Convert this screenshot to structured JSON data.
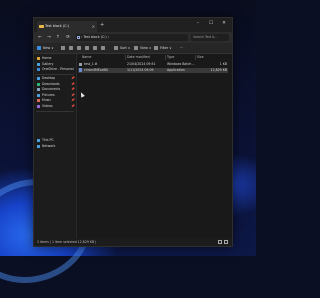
{
  "window": {
    "tab_title": "Test block (C:)",
    "tab_close": "×",
    "new_tab": "+",
    "controls": [
      "–",
      "☐",
      "✕"
    ]
  },
  "address": {
    "nav": [
      "←",
      "→",
      "↑",
      "⟳"
    ],
    "path": "›  Test block (C:)  ›",
    "search_placeholder": "Search Test b..."
  },
  "toolbar": {
    "new_label": "New ∨",
    "sort_label": "Sort ∨",
    "view_label": "View ∨",
    "filter_label": "Filter ∨",
    "more_label": "···"
  },
  "sidebar": {
    "items": [
      {
        "label": "Home",
        "color": "#e0a93a"
      },
      {
        "label": "Gallery",
        "color": "#4aa3e0"
      },
      {
        "label": "OneDrive - Personal",
        "color": "#3a8de0"
      },
      {
        "label": "Desktop",
        "color": "#4aa0e8",
        "pinned": "📌"
      },
      {
        "label": "Downloads",
        "color": "#2fb57a",
        "pinned": "📌"
      },
      {
        "label": "Documents",
        "color": "#8aa5c2",
        "pinned": "📌"
      },
      {
        "label": "Pictures",
        "color": "#4fa0e0",
        "pinned": "📌"
      },
      {
        "label": "Music",
        "color": "#e06a5a",
        "pinned": "📌"
      },
      {
        "label": "Videos",
        "color": "#9a6ae0",
        "pinned": "📌"
      },
      {
        "label": "This PC",
        "color": "#4aa3e0"
      },
      {
        "label": "Network",
        "color": "#4aa3e0"
      }
    ]
  },
  "columns": [
    "Name",
    "Date modified",
    "Type",
    "Size"
  ],
  "files": [
    {
      "name": "test_1.tt",
      "date": "21/04/2024 09:51",
      "type": "Windows Batch ...",
      "size": "1 KB",
      "color": "#9aa3ad"
    },
    {
      "name": "chron4MELaBG",
      "date": "1/11/2024 09:09",
      "type": "Application",
      "size": "12,829 KB",
      "color": "#6a8fd0"
    }
  ],
  "status": {
    "text": "2 items | 1 item selected  12,829 KB |"
  }
}
